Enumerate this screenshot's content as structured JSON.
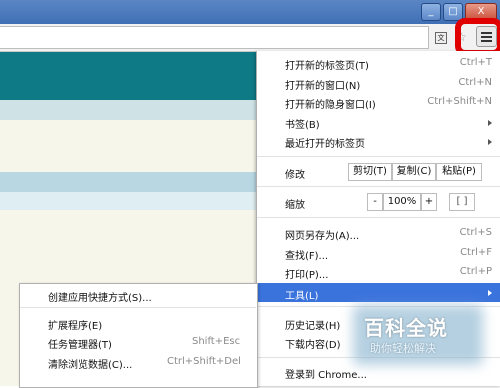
{
  "window": {
    "minimize": "_",
    "maximize": "□",
    "close": "X"
  },
  "toolbar": {
    "ext_icon": "translate-icon",
    "star_icon": "star-icon",
    "menu_icon": "hamburger-menu-icon"
  },
  "menu": {
    "new_tab": "打开新的标签页(T)",
    "new_tab_sc": "Ctrl+T",
    "new_window": "打开新的窗口(N)",
    "new_window_sc": "Ctrl+N",
    "incognito": "打开新的隐身窗口(I)",
    "incognito_sc": "Ctrl+Shift+N",
    "bookmarks": "书签(B)",
    "recent_tabs": "最近打开的标签页",
    "edit": {
      "label": "修改",
      "cut": "剪切(T)",
      "copy": "复制(C)",
      "paste": "粘贴(P)"
    },
    "zoom": {
      "label": "缩放",
      "minus": "-",
      "value": "100%",
      "plus": "+",
      "fullscreen": "[ ]"
    },
    "save_as": "网页另存为(A)...",
    "save_as_sc": "Ctrl+S",
    "find": "查找(F)...",
    "find_sc": "Ctrl+F",
    "print": "打印(P)...",
    "print_sc": "Ctrl+P",
    "tools": "工具(L)",
    "history": "历史记录(H)",
    "downloads": "下载内容(D)",
    "signin": "登录到 Chrome..."
  },
  "submenu": {
    "create_shortcut": "创建应用快捷方式(S)...",
    "extensions": "扩展程序(E)",
    "task_manager": "任务管理器(T)",
    "task_manager_sc": "Shift+Esc",
    "clear_data": "清除浏览数据(C)...",
    "clear_data_sc": "Ctrl+Shift+Del"
  },
  "watermark": {
    "title": "百科全说",
    "subtitle": "助你轻松解决"
  },
  "colors": {
    "highlight": "#3b73dd",
    "teal": "#0e7a86",
    "annotation": "#e00000"
  }
}
